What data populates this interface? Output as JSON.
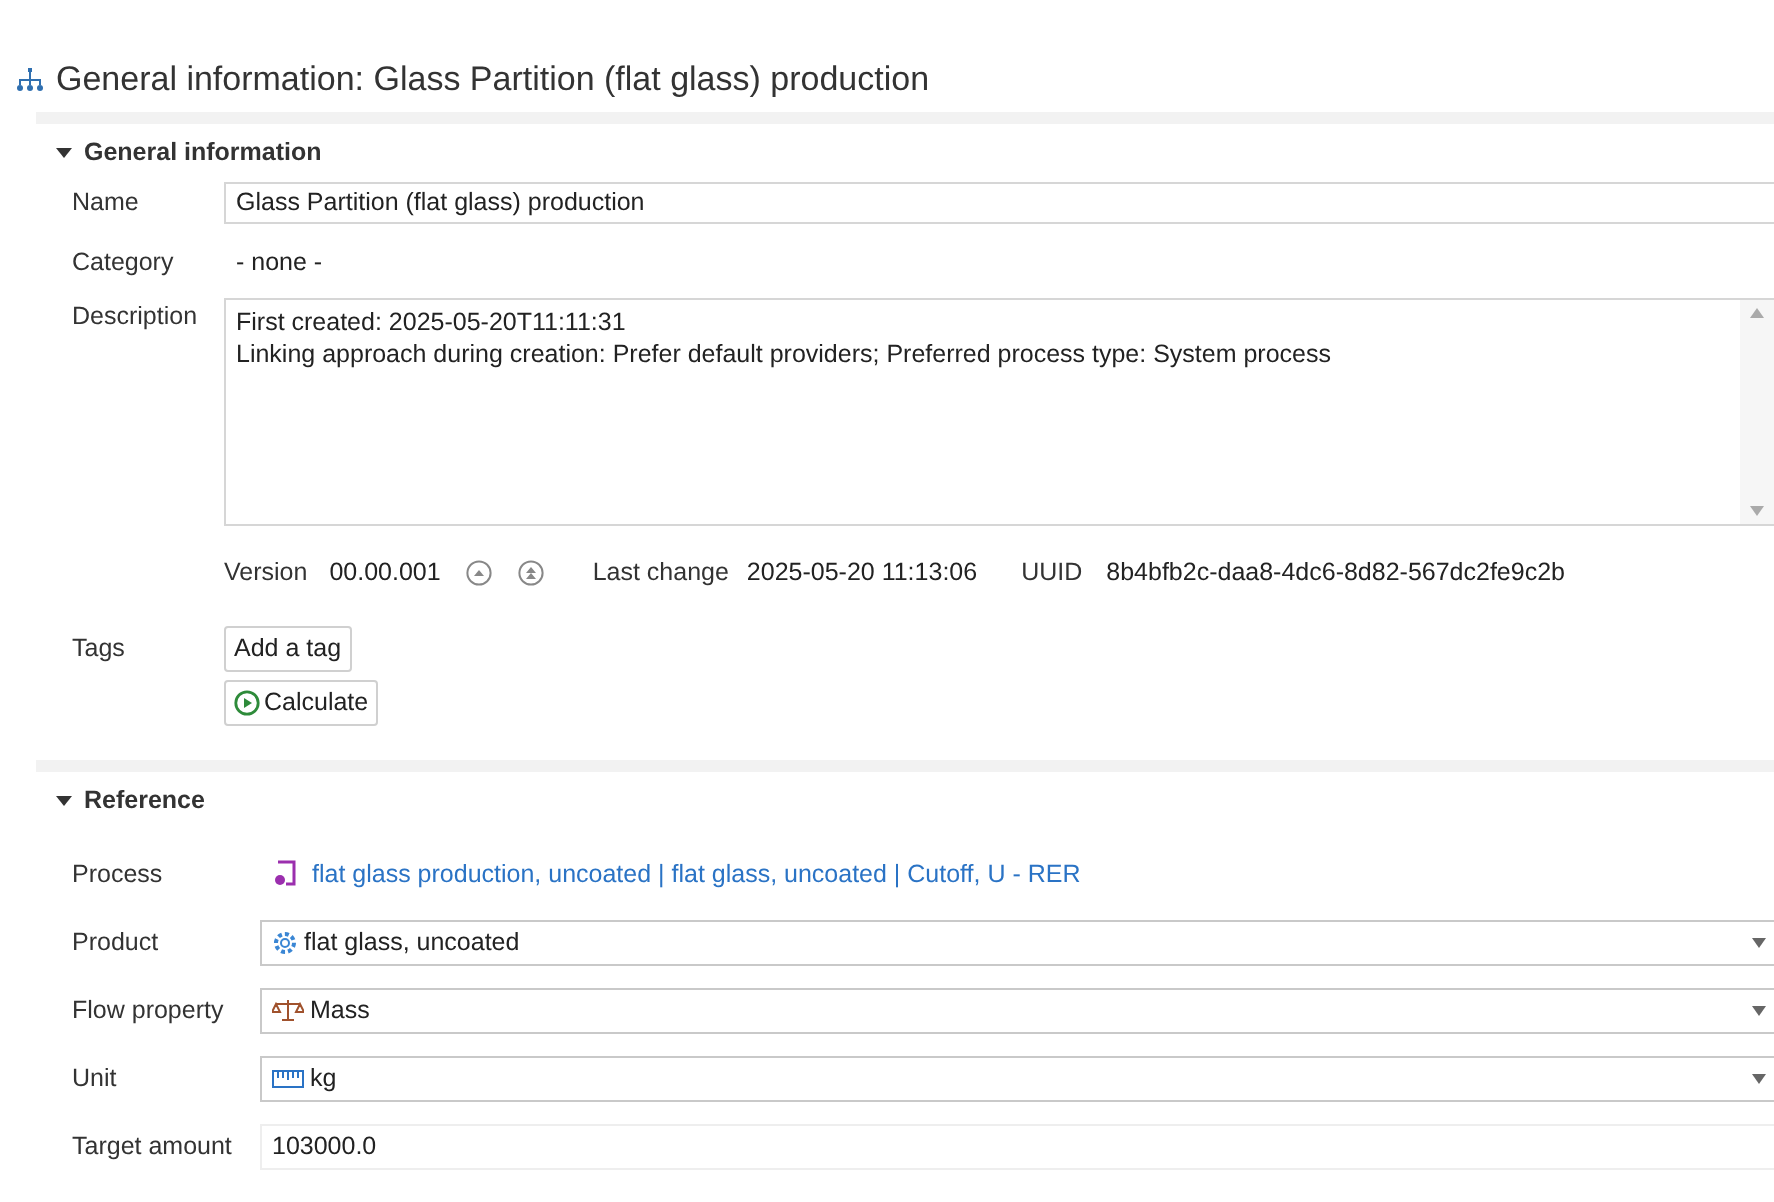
{
  "title": "General information: Glass Partition (flat glass) production",
  "general": {
    "title": "General information",
    "expanded": true,
    "name": {
      "label": "Name",
      "value": "Glass Partition (flat glass) production"
    },
    "category": {
      "label": "Category",
      "value": "- none -"
    },
    "description": {
      "label": "Description",
      "lines": [
        "First created: 2025-05-20T11:11:31",
        "Linking approach during creation: Prefer default providers; Preferred process type: System process"
      ]
    },
    "version": {
      "label": "Version",
      "value": "00.00.001"
    },
    "last_change": {
      "label": "Last change",
      "value": "2025-05-20 11:13:06"
    },
    "uuid": {
      "label": "UUID",
      "value": "8b4bfb2c-daa8-4dc6-8d82-567dc2fe9c2b"
    },
    "tags": {
      "label": "Tags",
      "button": "Add a tag"
    },
    "calculate": "Calculate"
  },
  "reference": {
    "title": "Reference",
    "expanded": true,
    "process": {
      "label": "Process",
      "value": "flat glass production, uncoated | flat glass, uncoated | Cutoff, U - RER"
    },
    "combos": [
      {
        "kind": "gear",
        "label": "Product",
        "value": "flat glass, uncoated"
      },
      {
        "kind": "scale",
        "label": "Flow property",
        "value": "Mass"
      },
      {
        "kind": "ruler",
        "label": "Unit",
        "value": "kg"
      }
    ],
    "target_amount": {
      "label": "Target amount",
      "value": "103000.0"
    }
  }
}
